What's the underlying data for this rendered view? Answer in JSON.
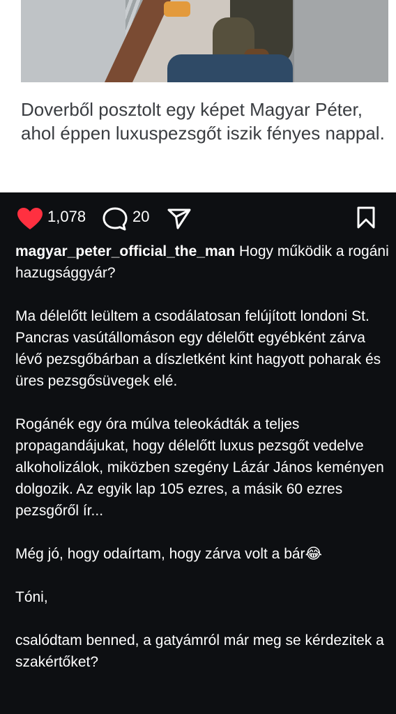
{
  "article": {
    "headline": "Doverből posztolt egy képet Magyar Péter, ahol éppen luxuspezsgőt iszik fényes nappal."
  },
  "actions": {
    "likes": "1,078",
    "comments": "20"
  },
  "post": {
    "username": "magyar_peter_official_the_man",
    "caption_lead": "Hogy működik a rogáni hazugsággyár?",
    "paragraphs": [
      "Ma délelőtt leültem a csodálatosan felújított londoni St. Pancras vasútállomáson egy délelőtt egyébként zárva lévő pezsgőbárban a díszletként kint hagyott poharak és üres pezsgősüvegek elé.",
      "Rogánék egy óra múlva teleokádták a teljes propagandájukat, hogy délelőtt luxus pezsgőt vedelve alkoholizálok, miközben szegény Lázár János keményen dolgozik. Az egyik lap 105 ezres, a másik 60 ezres pezsgőről ír...",
      "Még jó, hogy odaírtam, hogy zárva volt a bár😂",
      "Tóni,",
      "csalódtam benned, a gatyámról már meg se kérdezitek a szakértőket?"
    ]
  }
}
